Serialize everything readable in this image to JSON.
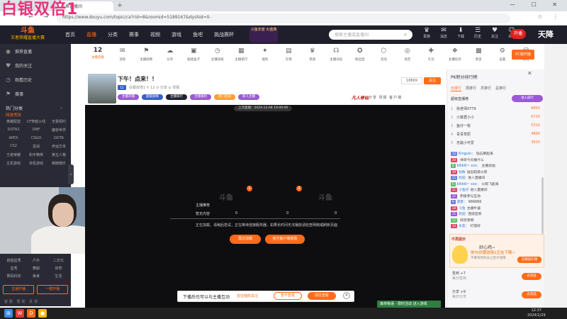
{
  "overlay_title": "白银双倍1",
  "browser": {
    "tab_title": "斗鱼直播间",
    "new_tab": "+",
    "window_controls": "— ☐ ✕",
    "nav": "← → ⟳",
    "url": "https://www.douyu.com/topic/ca?rid=8&roomid=5189167&dyshid=0-",
    "addr_icons": "☆ ⋮"
  },
  "site": {
    "logo_line1": "斗鱼",
    "logo_line2": "王者荣耀直播大赛",
    "nav": [
      "首页",
      "直播",
      "分类",
      "赛事",
      "视频",
      "游戏",
      "鱼吧",
      "挑战赛杯"
    ],
    "nav_active_index": 1,
    "promo": "斗鱼年度 大盛典",
    "search_placeholder": "搜索主播或直播间",
    "search_icon": "search-icon",
    "header_icons": [
      {
        "glyph": "♛",
        "label": "贵族"
      },
      {
        "glyph": "✉",
        "label": "消息"
      },
      {
        "glyph": "⬇",
        "label": "下载"
      },
      {
        "glyph": "☰",
        "label": "历史"
      },
      {
        "glyph": "♥",
        "label": "关注"
      },
      {
        "glyph": "☺",
        "label": "头像"
      }
    ],
    "live_btn": "开播",
    "brand_right": "天降"
  },
  "sidebar": {
    "items": [
      {
        "icon": "◉",
        "label": "推荐直播"
      },
      {
        "icon": "♥",
        "label": "我的关注"
      },
      {
        "icon": "◷",
        "label": "观看历史"
      },
      {
        "icon": "⚑",
        "label": "赛事"
      }
    ],
    "cat_title": "热门分类",
    "collapse": "⌄",
    "section_title": "网游竞技",
    "grid": [
      "英雄联盟",
      "CF穿越火线",
      "无畏契约",
      "DOTA2",
      "DNF",
      "魔兽世界",
      "APEX",
      "CSGO",
      "DOTA",
      "CS2",
      "逆战",
      "命运方舟",
      "王者荣耀",
      "和平精英",
      "第五人格",
      "主机游戏",
      "单机游戏",
      "棋牌娱乐"
    ],
    "grid2": [
      "颜值星秀",
      "户外",
      "二次元",
      "星秀",
      "舞蹈",
      "体育",
      "数码科技",
      "美食",
      "生活"
    ],
    "btn_left": "主播开播",
    "btn_right": "一键开播",
    "footer": "客服 帮助 反馈",
    "handle": "‹"
  },
  "channel_icons": {
    "level_num": "12",
    "level_label": "主播等级",
    "items": [
      {
        "glyph": "✉",
        "label": "消息"
      },
      {
        "glyph": "⚑",
        "label": "主播勋章"
      },
      {
        "glyph": "☁",
        "label": "分享"
      },
      {
        "glyph": "▣",
        "label": "超级盒子"
      },
      {
        "glyph": "◷",
        "label": "主播排班"
      },
      {
        "glyph": "▦",
        "label": "主播排行"
      },
      {
        "glyph": "✦",
        "label": "福利"
      },
      {
        "glyph": "▤",
        "label": "礼物"
      },
      {
        "glyph": "♛",
        "label": "贵族"
      },
      {
        "glyph": "☊",
        "label": "主播动态"
      },
      {
        "glyph": "✪",
        "label": "粉丝团"
      },
      {
        "glyph": "⬡",
        "label": "活动"
      },
      {
        "glyph": "◎",
        "label": "语音"
      },
      {
        "glyph": "✚",
        "label": "礼包"
      },
      {
        "glyph": "❖",
        "label": "主播任务"
      },
      {
        "glyph": "▩",
        "label": "更多"
      },
      {
        "glyph": "⚙",
        "label": "设置"
      },
      {
        "glyph": "☺",
        "label": "关注"
      }
    ],
    "right_btn": "PC端开播"
  },
  "room": {
    "title": "下午！点来！！",
    "badge": "12",
    "meta": "白银双倍1   ⚲ 12   ◷ 分享   ◎ 举报",
    "tags": [
      {
        "label": "主播开播",
        "color": "#9b59d6"
      },
      {
        "label": "超级勋章",
        "color": "#3a5fcd"
      },
      {
        "label": "主播排行",
        "color": "#222233"
      },
      {
        "label": "主播福利",
        "color": "#9b59d6"
      },
      {
        "label": "热门活动",
        "color": "#ff9f2e"
      },
      {
        "label": "新人主播",
        "color": "#9b59d6"
      }
    ],
    "follow_num": "18869",
    "follow_btn": "关注",
    "fireworks": "凡人修仙",
    "links": "分享  举报  客户端"
  },
  "player": {
    "timestamp": "上次直播：2024-12-08 19:09:00",
    "logos": [
      "斗鱼",
      "斗鱼"
    ],
    "dot1": "1",
    "dot2": "2",
    "label_left": "主播推荐",
    "label_left2": "暂无内容",
    "v1": "0",
    "v2": "0",
    "v3": "0",
    "msg": "正在加载，请稍后尝试，正在等待连接服务器，如果长时间无法播放请检查网络或刷新页面",
    "btn_primary": "再次加载",
    "btn_secondary": "官方客户端观看"
  },
  "notification": {
    "text": "下播后也可以与主播互动",
    "link": "去往我的关注",
    "btn_cancel": "暂不查看",
    "btn_ok": "前往查看",
    "close": "✕"
  },
  "bottom_game": "森林物语 - 限时活动 进入游戏",
  "right_panel": {
    "title": "PK积分排行榜",
    "close": "✕",
    "tabs": [
      "日排行",
      "周排行",
      "月排行",
      "总排行"
    ],
    "tabs_active_index": 0,
    "rank_title": "超级直播榜",
    "rank_btn": "进入排行",
    "ranks": [
      {
        "num": "1",
        "name": "张老师0779",
        "score": "8850"
      },
      {
        "num": "2",
        "name": "小葵君小小",
        "score": "6720"
      },
      {
        "num": "3",
        "name": "鱼仔一枚",
        "score": "5310"
      },
      {
        "num": "4",
        "name": "青青草原",
        "score": "4890"
      },
      {
        "num": "5",
        "name": "无敌小可爱",
        "score": "3620"
      }
    ],
    "chat": [
      {
        "lv": "13",
        "lvc": "#6a82d8",
        "nick": "Kinguin：",
        "text": "钻石刷起来"
      },
      {
        "lv": "20",
        "lvc": "#d84a6a",
        "nick": "",
        "text": "帅哥今天播什么"
      },
      {
        "lv": "8",
        "lvc": "#5bbf6a",
        "nick": "bilibili~ xxx：",
        "text": "主播加油"
      },
      {
        "lv": "30",
        "lvc": "#d84a6a",
        "nick": "钻粉",
        "text": "送出超级火箭"
      },
      {
        "lv": "15",
        "lvc": "#6a82d8",
        "nick": "欢迎 ",
        "text": "进入直播间"
      },
      {
        "lv": "6",
        "lvc": "#5bbf6a",
        "nick": "bilibili~ xxx：",
        "text": "火箭飞起来"
      },
      {
        "lv": "11",
        "lvc": "#d84a6a",
        "nick": "小鱼仔",
        "text": "进入直播间"
      },
      {
        "lv": "22",
        "lvc": "#9b59d6",
        "nick": "",
        "text": "积极参与互动"
      },
      {
        "lv": "9",
        "lvc": "#6a82d8",
        "nick": "游客：",
        "text": "666666"
      },
      {
        "lv": "18",
        "lvc": "#d84a6a",
        "nick": "斗鱼",
        "text": "主播牛逼"
      },
      {
        "lv": "25",
        "lvc": "#9b59d6",
        "nick": "欢迎 ",
        "text": "连续签到"
      },
      {
        "lv": "12",
        "lvc": "#5bbf6a",
        "nick": "",
        "text": "好厉害啊"
      },
      {
        "lv": "14",
        "lvc": "#d84a6a",
        "nick": "水友：",
        "text": "打得好"
      }
    ],
    "gift_popup": {
      "title": "不再提示",
      "head": "好心鸡~",
      "body": "你与白银双倍1正在下降~",
      "sub": "不要等到失去之后才后悔",
      "btn": "去赠送礼物"
    },
    "tasks": [
      {
        "label": "签到 +7",
        "sub": "每日签到",
        "btn": "去完成"
      },
      {
        "label": "分享 +9",
        "sub": "每日分享",
        "btn": "去完成"
      }
    ]
  },
  "taskbar": {
    "time": "12:37",
    "date": "2024/1/29",
    "icons": [
      {
        "glyph": "⊞",
        "color": "#3a8ee6"
      },
      {
        "glyph": "W",
        "color": "#e53935"
      },
      {
        "glyph": "D",
        "color": "#ff6b1a"
      },
      {
        "glyph": "●",
        "color": "#fbbc05"
      }
    ]
  }
}
